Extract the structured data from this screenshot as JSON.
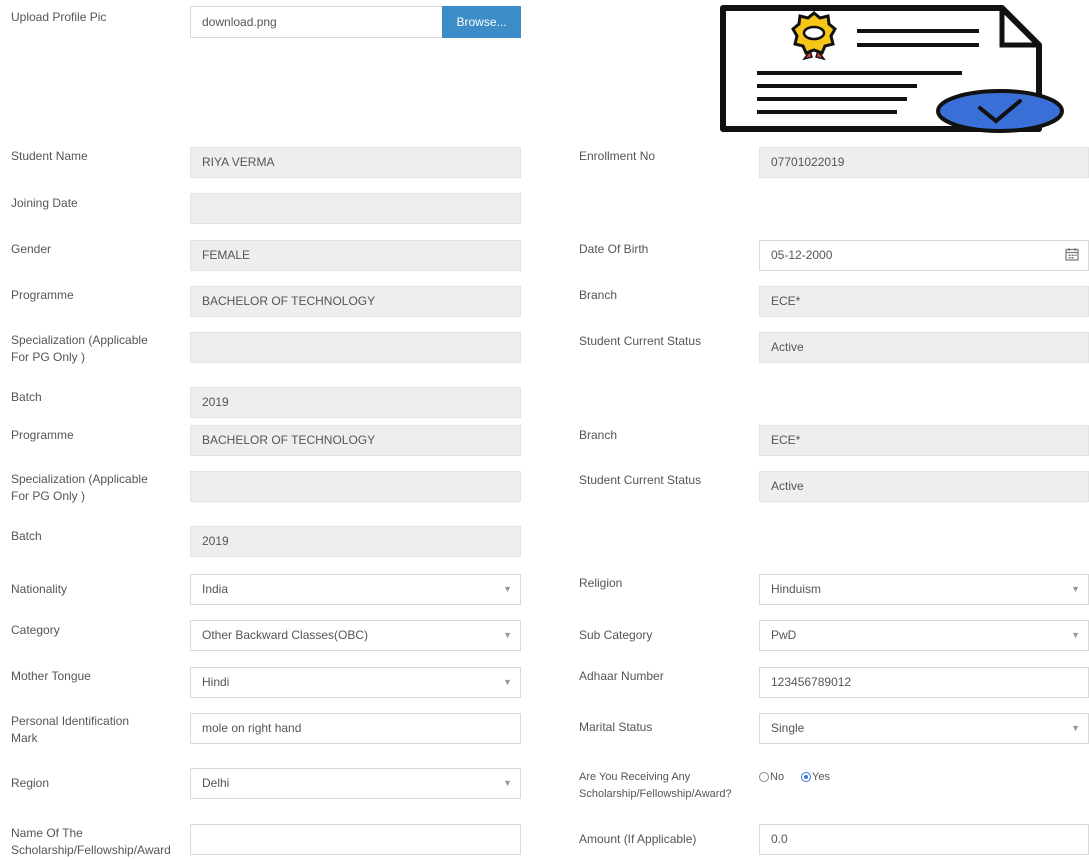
{
  "upload": {
    "label": "Upload Profile Pic",
    "file_name": "download.png",
    "browse_label": "Browse..."
  },
  "student_name": {
    "label": "Student Name",
    "value": "RIYA VERMA"
  },
  "enrollment_no": {
    "label": "Enrollment No",
    "value": "07701022019"
  },
  "joining_date": {
    "label": "Joining Date",
    "value": ""
  },
  "gender": {
    "label": "Gender",
    "value": "FEMALE"
  },
  "dob": {
    "label": "Date Of Birth",
    "value": "05-12-2000"
  },
  "academic": [
    {
      "programme_label": "Programme",
      "programme": "BACHELOR OF TECHNOLOGY",
      "branch_label": "Branch",
      "branch": "ECE*",
      "spec_label_1": "Specialization (Applicable",
      "spec_label_2": "For PG Only )",
      "spec": "",
      "status_label": "Student Current Status",
      "status": "Active",
      "batch_label": "Batch",
      "batch": "2019"
    },
    {
      "programme_label": "Programme",
      "programme": "BACHELOR OF TECHNOLOGY",
      "branch_label": "Branch",
      "branch": "ECE*",
      "spec_label_1": "Specialization (Applicable",
      "spec_label_2": "For PG Only )",
      "spec": "",
      "status_label": "Student Current Status",
      "status": "Active",
      "batch_label": "Batch",
      "batch": "2019"
    }
  ],
  "nationality": {
    "label": "Nationality",
    "value": "India"
  },
  "religion": {
    "label": "Religion",
    "value": "Hinduism"
  },
  "category": {
    "label": "Category",
    "value": "Other Backward Classes(OBC)"
  },
  "sub_category": {
    "label": "Sub Category",
    "value": "PwD"
  },
  "mother_tongue": {
    "label": "Mother Tongue",
    "value": "Hindi"
  },
  "adhaar": {
    "label": "Adhaar Number",
    "value": "123456789012"
  },
  "pim": {
    "label_1": "Personal Identification",
    "label_2": "Mark",
    "value": "mole on right hand"
  },
  "marital": {
    "label": "Marital Status",
    "value": "Single"
  },
  "region": {
    "label": "Region",
    "value": "Delhi"
  },
  "scholarship_q": {
    "label_1": "Are You Receiving Any",
    "label_2": "Scholarship/Fellowship/Award?",
    "no_label": "No",
    "yes_label": "Yes",
    "selected": "Yes"
  },
  "scholarship_name": {
    "label_1": "Name Of The",
    "label_2": "Scholarship/Fellowship/Award",
    "value": ""
  },
  "amount": {
    "label": "Amount (If Applicable)",
    "value": "0.0"
  },
  "icons": {
    "caret": "▼",
    "certificate": "certificate-icon",
    "calendar": "calendar-icon"
  },
  "colors": {
    "browse": "#3b8cc7",
    "readonly": "#eeeeee",
    "seal": "#f5c518",
    "check": "#3a6fd8"
  }
}
